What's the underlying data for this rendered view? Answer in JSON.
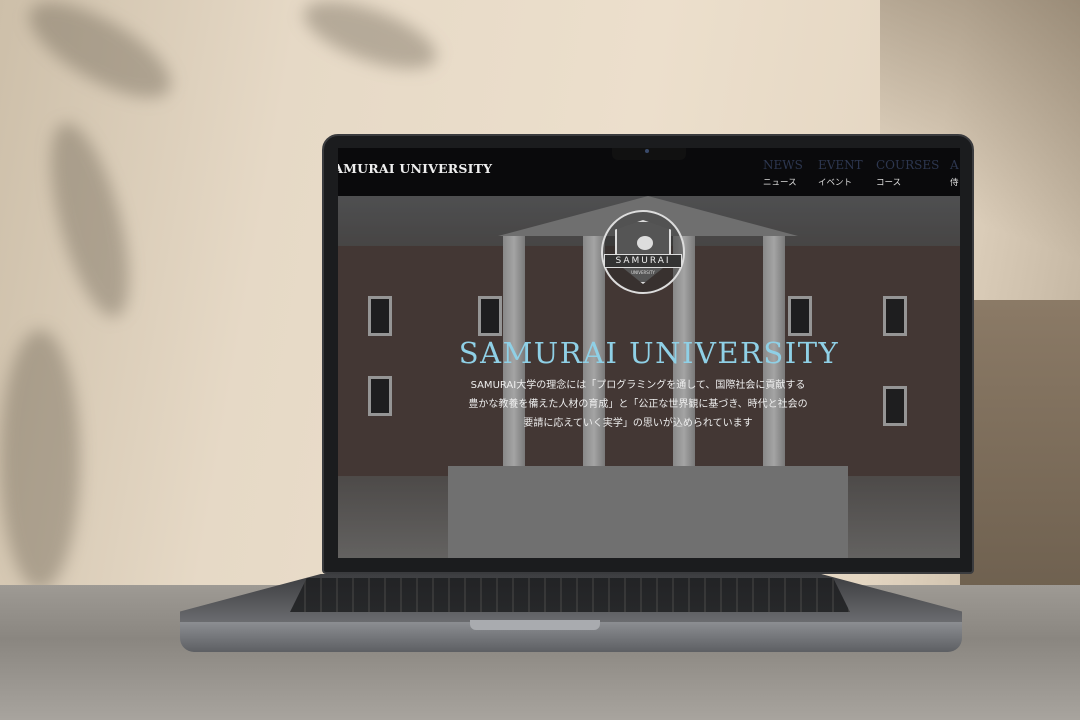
{
  "site": {
    "brand": "SAMURAI UNIVERSITY",
    "nav": [
      {
        "en": "NEWS",
        "ja": "ニュース"
      },
      {
        "en": "EVENT",
        "ja": "イベント"
      },
      {
        "en": "COURSES",
        "ja": "コース"
      },
      {
        "en": "A",
        "ja": "侍"
      }
    ],
    "emblem": {
      "name": "SAMURAI",
      "sub": "UNIVERSITY"
    },
    "hero": {
      "title": "SAMURAI UNIVERSITY",
      "description": "SAMURAI大学の理念には「プログラミングを通して、国際社会に貢献する豊かな教養を備えた人材の育成」と「公正な世界観に基づき、時代と社会の要請に応えていく実学」の思いが込められています",
      "slides_total": 3,
      "slide_active": 1
    }
  },
  "colors": {
    "title": "#8fd0e6",
    "navbar": "#0a0a0c",
    "nav_en": "#2d3750"
  }
}
